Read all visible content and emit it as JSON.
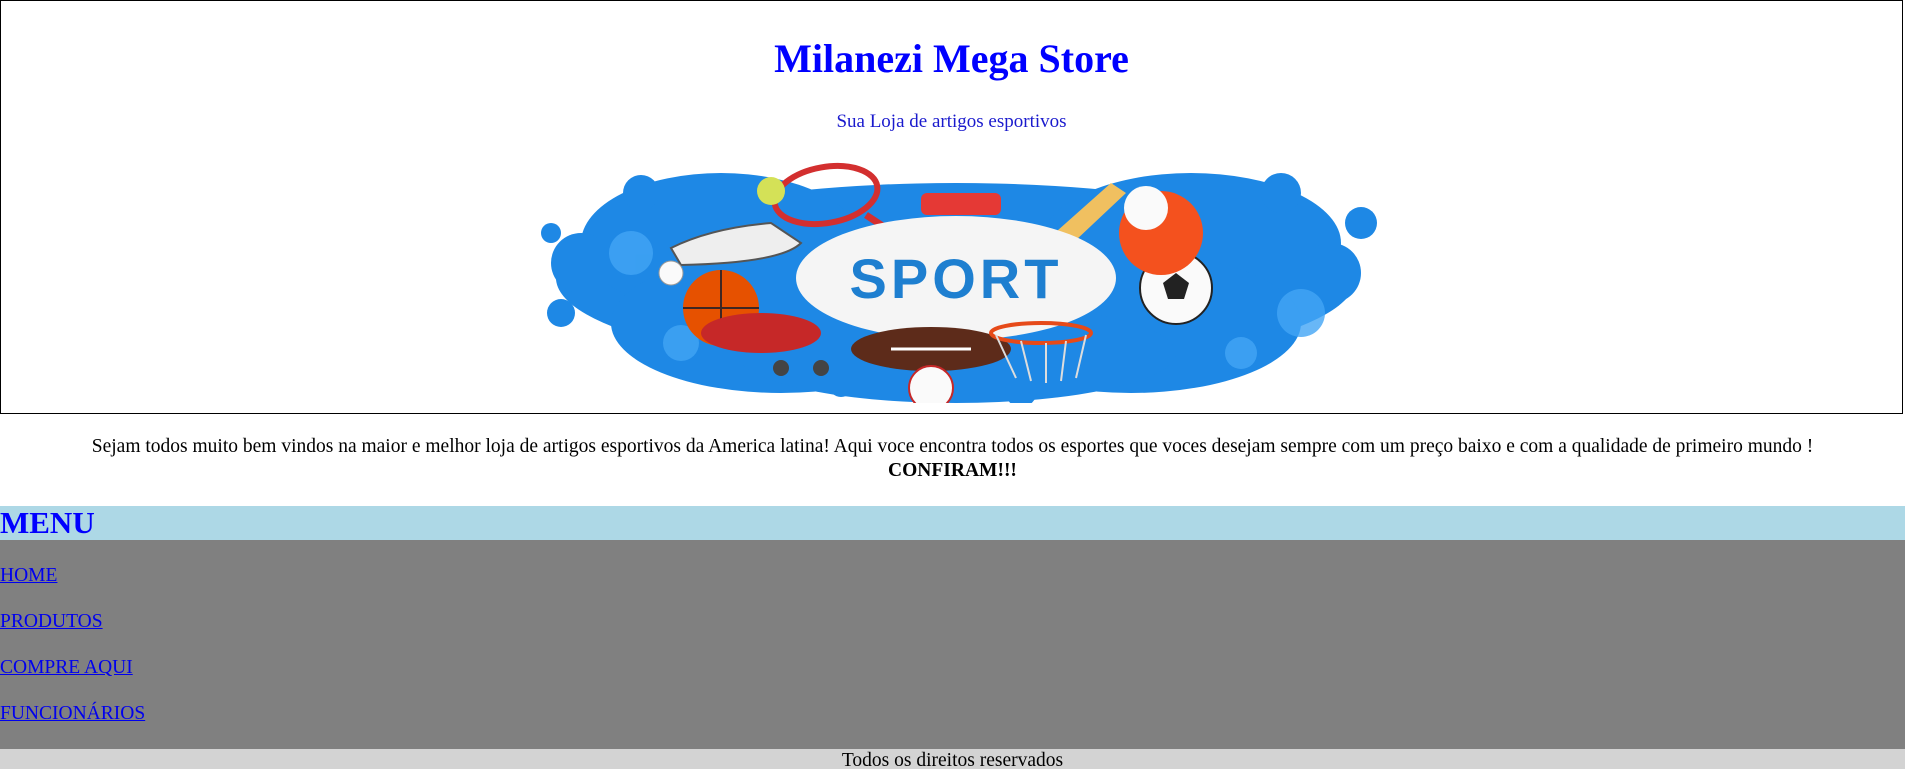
{
  "header": {
    "title": "Milanezi Mega Store",
    "subtitle": "Sua Loja de artigos esportivos",
    "banner_text": "SPORT"
  },
  "welcome": {
    "text": "Sejam todos muito bem vindos na maior e melhor loja de artigos esportivos da America latina! Aqui voce encontra todos os esportes que voces desejam sempre com um preço baixo e com a qualidade de primeiro mundo !",
    "cta": "CONFIRAM!!!"
  },
  "menu": {
    "title": "MENU",
    "items": [
      {
        "label": "HOME"
      },
      {
        "label": "PRODUTOS"
      },
      {
        "label": "COMPRE AQUI"
      },
      {
        "label": "FUNCIONÁRIOS"
      }
    ]
  },
  "footer": {
    "text": "Todos os direitos reservados"
  },
  "colors": {
    "title": "#0000ff",
    "menu_bg": "#add8e6",
    "list_bg": "#808080",
    "footer_bg": "#d3d3d3",
    "banner_blue": "#1e88e5",
    "sport_text": "#1e7fd0"
  }
}
